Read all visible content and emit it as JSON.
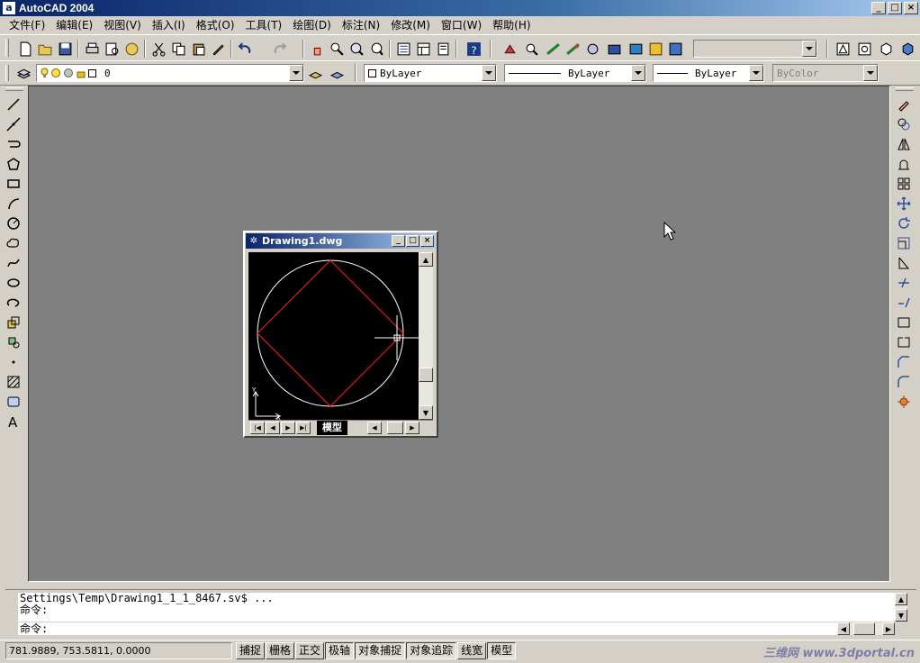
{
  "app": {
    "title": "AutoCAD 2004",
    "icon": "a"
  },
  "menus": [
    "文件(F)",
    "编辑(E)",
    "视图(V)",
    "插入(I)",
    "格式(O)",
    "工具(T)",
    "绘图(D)",
    "标注(N)",
    "修改(M)",
    "窗口(W)",
    "帮助(H)"
  ],
  "properties": {
    "layer_value": "0",
    "color_value": "ByLayer",
    "linetype_value": "ByLayer",
    "lineweight_value": "ByLayer",
    "plotstyle_value": "ByColor",
    "named_views_value": ""
  },
  "document": {
    "title": "Drawing1.dwg",
    "tab_model": "模型",
    "ucs_y": "Y",
    "ucs_x": "X"
  },
  "command": {
    "history": [
      "Settings\\Temp\\Drawing1_1_1_8467.sv$ ...",
      "命令:"
    ],
    "prompt": "命令:"
  },
  "status": {
    "coords": "781.9889,  753.5811,  0.0000",
    "toggles": [
      "捕捉",
      "栅格",
      "正交",
      "极轴",
      "对象捕捉",
      "对象追踪",
      "线宽",
      "模型"
    ],
    "toggles_on": [
      false,
      false,
      false,
      true,
      true,
      true,
      false,
      true
    ],
    "watermark": "三维网 www.3dportal.cn"
  },
  "colors": {
    "circle": "#ffffff",
    "square": "#ff2020",
    "workspace": "#808080",
    "title_start": "#0a246a"
  }
}
